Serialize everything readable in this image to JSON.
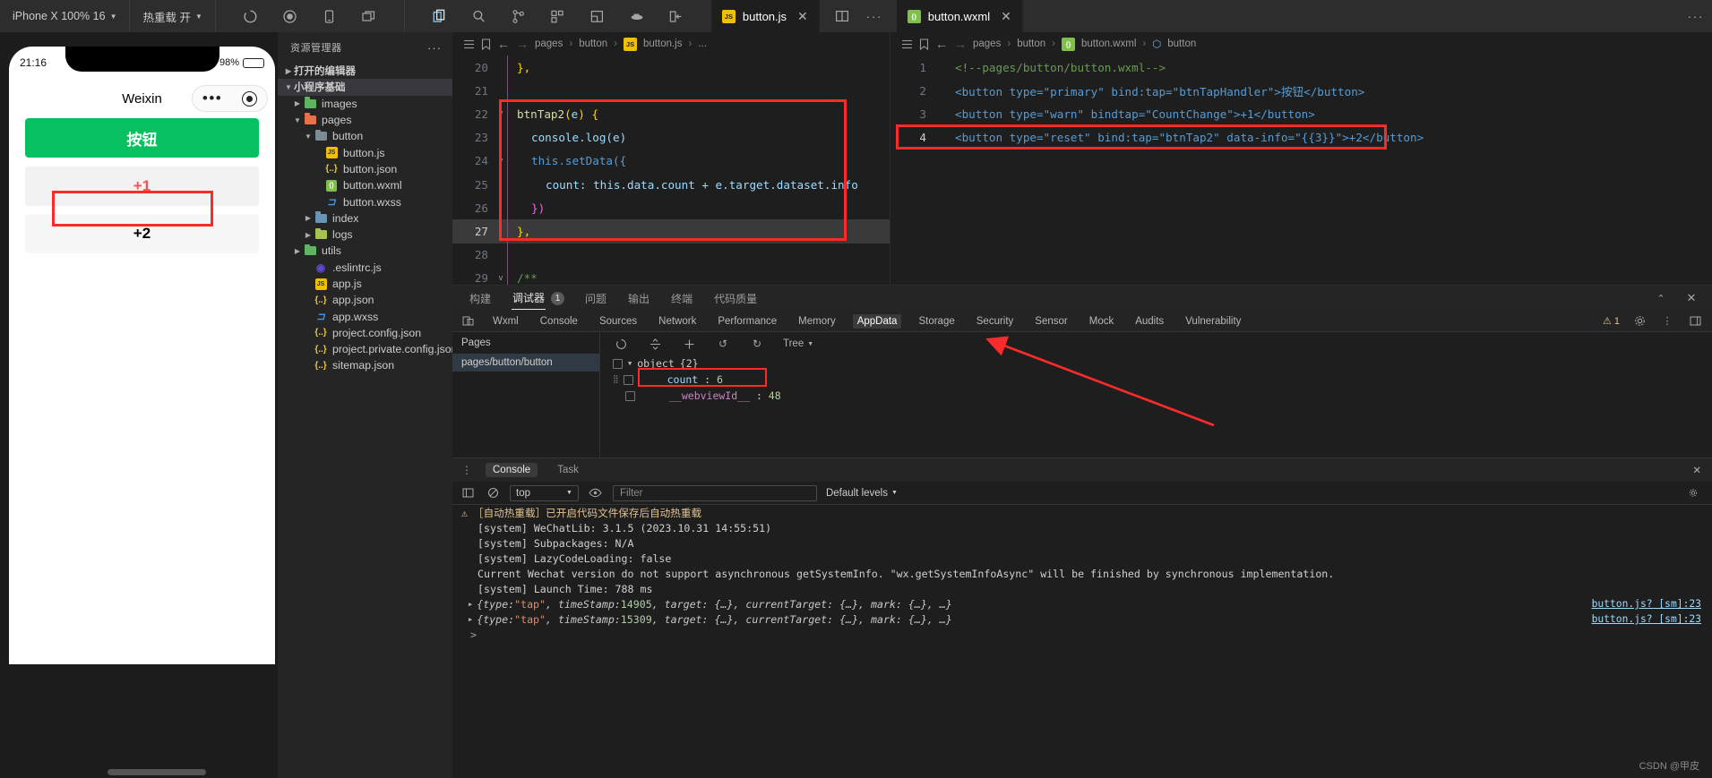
{
  "topbar": {
    "device_label": "iPhone X 100% 16",
    "hotreload_label": "热重载 开",
    "icons": [
      "refresh-icon",
      "record-icon",
      "mobile-icon",
      "window-icon",
      "explorer-icon",
      "search-icon",
      "source-control-icon",
      "extensions-icon",
      "layout-icon",
      "docker-icon",
      "panel-toggle-icon"
    ],
    "split_icon": "split-editor-icon",
    "more_icon": "more-icon"
  },
  "explorer": {
    "title": "资源管理器",
    "more": "···",
    "sections": [
      {
        "label": "打开的编辑器",
        "open": false
      },
      {
        "label": "小程序基础",
        "open": true
      }
    ],
    "tree": [
      {
        "label": "images",
        "depth": 1,
        "twist": "closed",
        "icon": "folder-green"
      },
      {
        "label": "pages",
        "depth": 1,
        "twist": "open",
        "icon": "folder-red"
      },
      {
        "label": "button",
        "depth": 2,
        "twist": "open",
        "icon": "folder-plain"
      },
      {
        "label": "button.js",
        "depth": 3,
        "twist": "none",
        "icon": "js"
      },
      {
        "label": "button.json",
        "depth": 3,
        "twist": "none",
        "icon": "json"
      },
      {
        "label": "button.wxml",
        "depth": 3,
        "twist": "none",
        "icon": "wxml"
      },
      {
        "label": "button.wxss",
        "depth": 3,
        "twist": "none",
        "icon": "wxss"
      },
      {
        "label": "index",
        "depth": 2,
        "twist": "closed",
        "icon": "folder-blue"
      },
      {
        "label": "logs",
        "depth": 2,
        "twist": "closed",
        "icon": "folder-lime"
      },
      {
        "label": "utils",
        "depth": 1,
        "twist": "closed",
        "icon": "folder-green"
      },
      {
        "label": ".eslintrc.js",
        "depth": 1,
        "twist": "none",
        "icon": "eslint"
      },
      {
        "label": "app.js",
        "depth": 1,
        "twist": "none",
        "icon": "js"
      },
      {
        "label": "app.json",
        "depth": 1,
        "twist": "none",
        "icon": "json"
      },
      {
        "label": "app.wxss",
        "depth": 1,
        "twist": "none",
        "icon": "wxss"
      },
      {
        "label": "project.config.json",
        "depth": 1,
        "twist": "none",
        "icon": "json"
      },
      {
        "label": "project.private.config.json",
        "depth": 1,
        "twist": "none",
        "icon": "json"
      },
      {
        "label": "sitemap.json",
        "depth": 1,
        "twist": "none",
        "icon": "json"
      }
    ]
  },
  "simulator": {
    "time": "21:16",
    "battery": "98%",
    "nav_title": "Weixin",
    "buttons": [
      {
        "label": "按钮",
        "style": "primary"
      },
      {
        "label": "+1",
        "style": "warn"
      },
      {
        "label": "+2",
        "style": "reset",
        "highlighted": true
      }
    ]
  },
  "editor_left": {
    "tab": "button.js",
    "tab_icon": "js-file-icon",
    "breadcrumb": [
      "pages",
      "button",
      "button.js",
      "..."
    ],
    "lines": [
      {
        "num": "20",
        "fold": "",
        "current": false
      },
      {
        "num": "21",
        "fold": "",
        "current": false
      },
      {
        "num": "22",
        "fold": "v",
        "current": false
      },
      {
        "num": "23",
        "fold": "",
        "current": false
      },
      {
        "num": "24",
        "fold": "v",
        "current": false
      },
      {
        "num": "25",
        "fold": "",
        "current": false
      },
      {
        "num": "26",
        "fold": "",
        "current": false
      },
      {
        "num": "27",
        "fold": "",
        "current": true
      },
      {
        "num": "28",
        "fold": "",
        "current": false
      },
      {
        "num": "29",
        "fold": "v",
        "current": false
      }
    ],
    "code_text": {
      "l20": "},",
      "l22_fn": "btnTap2",
      "l22_paren_open": "(",
      "l22_arg": "e",
      "l22_paren_close": ")",
      "l22_brace": " {",
      "l23": "console.log(e)",
      "l24": "this.setData({",
      "l25": "count: this.data.count + e.target.dataset.info",
      "l26": "})",
      "l27": "},",
      "l29": "/**"
    }
  },
  "editor_right": {
    "tab": "button.wxml",
    "tab_icon": "wxml-file-icon",
    "breadcrumb": [
      "pages",
      "button",
      "button.wxml",
      "button"
    ],
    "lines": [
      {
        "num": "1",
        "text": "<!--pages/button/button.wxml-->"
      },
      {
        "num": "2",
        "text": "<button type=\"primary\" bind:tap=\"btnTapHandler\">按钮</button>"
      },
      {
        "num": "3",
        "text": "<button type=\"warn\" bindtap=\"CountChange\">+1</button>"
      },
      {
        "num": "4",
        "text": "<button type=\"reset\" bind:tap=\"btnTap2\" data-info=\"{{3}}\">+2</button>",
        "highlighted": true
      }
    ]
  },
  "bottom_tabs": {
    "items": [
      {
        "label": "构建",
        "active": false
      },
      {
        "label": "调试器",
        "active": true,
        "badge": "1"
      },
      {
        "label": "问题",
        "active": false
      },
      {
        "label": "输出",
        "active": false
      },
      {
        "label": "终端",
        "active": false
      },
      {
        "label": "代码质量",
        "active": false
      }
    ],
    "collapse_icon": "chevron-up-icon",
    "close_icon": "close-icon"
  },
  "inspector": {
    "device_icon": "device-toolbar-icon",
    "tabs": [
      {
        "label": "Wxml",
        "active": false
      },
      {
        "label": "Console",
        "active": false
      },
      {
        "label": "Sources",
        "active": false
      },
      {
        "label": "Network",
        "active": false
      },
      {
        "label": "Performance",
        "active": false
      },
      {
        "label": "Memory",
        "active": false
      },
      {
        "label": "AppData",
        "active": true
      },
      {
        "label": "Storage",
        "active": false
      },
      {
        "label": "Security",
        "active": false
      },
      {
        "label": "Sensor",
        "active": false
      },
      {
        "label": "Mock",
        "active": false
      },
      {
        "label": "Audits",
        "active": false
      },
      {
        "label": "Vulnerability",
        "active": false
      }
    ],
    "warning_count": "1",
    "warning_icon": "warning-triangle-icon",
    "settings_icon": "gear-icon",
    "kebab_icon": "more-vertical-icon",
    "dock_icon": "dock-icon",
    "pages_header": "Pages",
    "pages_selected": "pages/button/button",
    "toolbar": {
      "refresh_icon": "refresh-icon",
      "collapse_icon": "collapse-icon",
      "expand_icon": "expand-icon",
      "undo_icon": "undo-icon",
      "redo_icon": "redo-icon",
      "view_label": "Tree"
    },
    "appdata": [
      {
        "indent": 0,
        "twist": "open",
        "key": "object",
        "value": "{2}",
        "type": "obj",
        "highlighted": false
      },
      {
        "indent": 1,
        "twist": "",
        "key": "count",
        "value": "6",
        "type": "num",
        "highlighted": true
      },
      {
        "indent": 1,
        "twist": "",
        "key": "__webviewId__",
        "value": "48",
        "type": "num",
        "highlighted": false
      }
    ]
  },
  "console": {
    "tabs": [
      {
        "label": "Console",
        "active": true
      },
      {
        "label": "Task",
        "active": false
      }
    ],
    "close_icon": "close-icon",
    "kebab_icon": "more-vertical-icon",
    "controls": {
      "sidebar_icon": "console-sidebar-icon",
      "clear_icon": "clear-icon",
      "context": "top",
      "eye_icon": "eye-icon",
      "filter_placeholder": "Filter",
      "levels": "Default levels",
      "settings_icon": "gear-icon"
    },
    "messages": [
      {
        "kind": "warn",
        "text": "［自动热重载］已开启代码文件保存后自动热重载"
      },
      {
        "kind": "plain",
        "text": "[system] WeChatLib: 3.1.5 (2023.10.31 14:55:51)"
      },
      {
        "kind": "plain",
        "text": "[system] Subpackages: N/A"
      },
      {
        "kind": "plain",
        "text": "[system] LazyCodeLoading: false"
      },
      {
        "kind": "plain",
        "text": "Current Wechat version do not support asynchronous getSystemInfo. \"wx.getSystemInfoAsync\" will be finished by synchronous implementation."
      },
      {
        "kind": "plain",
        "text": "[system] Launch Time: 788 ms"
      },
      {
        "kind": "obj",
        "prefix": "{type: ",
        "str": "\"tap\"",
        "mid": ", timeStamp: ",
        "num": "14905",
        "suffix": ", target: {…}, currentTarget: {…}, mark: {…}, …}",
        "source": "button.js? [sm]:23"
      },
      {
        "kind": "obj",
        "prefix": "{type: ",
        "str": "\"tap\"",
        "mid": ", timeStamp: ",
        "num": "15309",
        "suffix": ", target: {…}, currentTarget: {…}, mark: {…}, …}",
        "source": "button.js? [sm]:23"
      }
    ],
    "prompt": ">"
  },
  "watermark": "CSDN @甲皮",
  "colors": {
    "accent_red": "#fc2b2b",
    "wechat_green": "#07c160",
    "warn_red": "#fa5151"
  }
}
